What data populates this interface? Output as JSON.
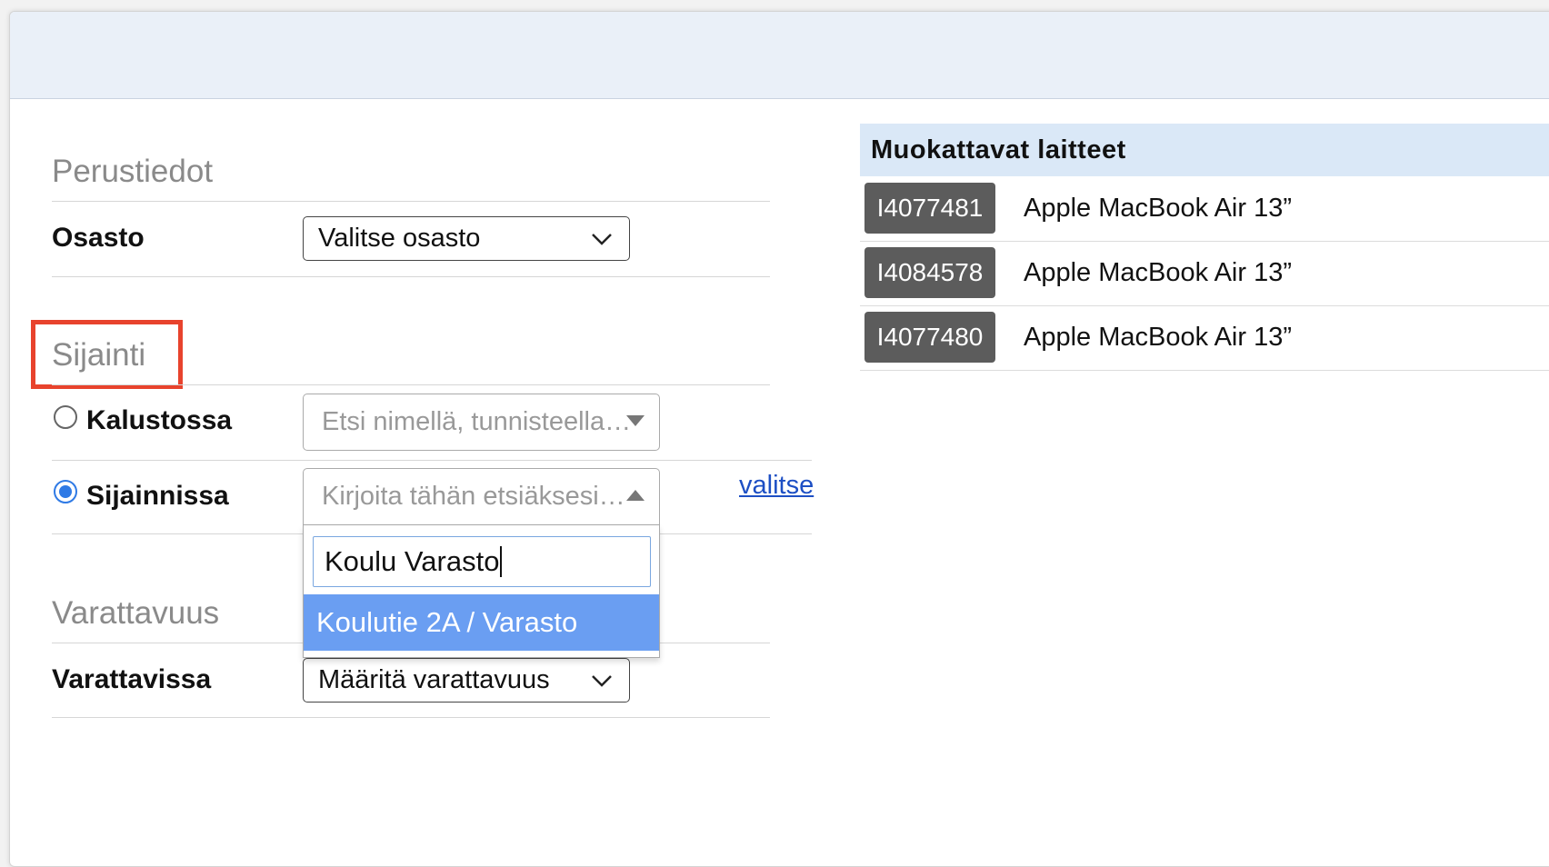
{
  "form": {
    "basic_section_title": "Perustiedot",
    "department_label": "Osasto",
    "department_select_value": "Valitse osasto",
    "location_section_title": "Sijainti",
    "radio_equipment_label": "Kalustossa",
    "radio_equipment_checked": false,
    "equipment_search_placeholder": "Etsi nimellä, tunnisteella…",
    "radio_location_label": "Sijainnissa",
    "radio_location_checked": true,
    "location_search_placeholder": "Kirjoita tähän etsiäksesi…",
    "choose_link": "valitse",
    "dropdown_search_value": "Koulu Varasto",
    "dropdown_options": [
      "Koulutie 2A / Varasto"
    ],
    "availability_section_title": "Varattavuus",
    "bookable_label": "Varattavissa",
    "bookable_select_value": "Määritä varattavuus"
  },
  "devices_panel": {
    "title": "Muokattavat laitteet",
    "devices": [
      {
        "id": "I4077481",
        "name": "Apple MacBook Air 13”"
      },
      {
        "id": "I4084578",
        "name": "Apple MacBook Air 13”"
      },
      {
        "id": "I4077480",
        "name": "Apple MacBook Air 13”"
      }
    ]
  },
  "colors": {
    "highlight": "#e8432d",
    "accent": "#2f7ae5",
    "selected_option": "#6a9ef2",
    "panel_header": "#dae8f7"
  }
}
